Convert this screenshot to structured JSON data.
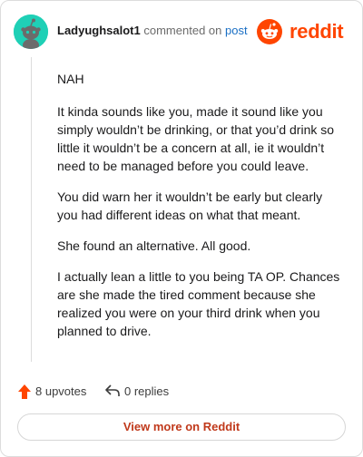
{
  "colors": {
    "avatar": "#1fd0b6",
    "reddit_orange": "#ff4500",
    "link_blue": "#1a6fc4",
    "button_text": "#c0391b",
    "upvote_arrow": "#ff4500"
  },
  "header": {
    "username": "Ladyughsalot1",
    "commented_on_text": "commented on",
    "post_link": "post",
    "brand": "reddit",
    "avatar_icon": "snoo-avatar-icon",
    "brand_icon": "reddit-logo-icon"
  },
  "comment": {
    "paragraphs": [
      "NAH",
      "It kinda sounds like you, made it sound like you simply wouldn’t be drinking, or that you’d drink so little it wouldn’t be a concern at all, ie it wouldn’t need to be managed before you could leave.",
      "You did warn her it wouldn’t be early but clearly you had different ideas on what that meant.",
      "She found an alternative. All good.",
      "I actually lean a little to you being TA OP. Chances are she made the tired comment because she realized you were on your third drink when you planned to drive."
    ]
  },
  "actions": {
    "upvotes": "8 upvotes",
    "replies": "0 replies",
    "upvote_icon": "upvote-arrow-icon",
    "reply_icon": "reply-arrow-icon"
  },
  "footer": {
    "view_more_label": "View more on Reddit"
  }
}
